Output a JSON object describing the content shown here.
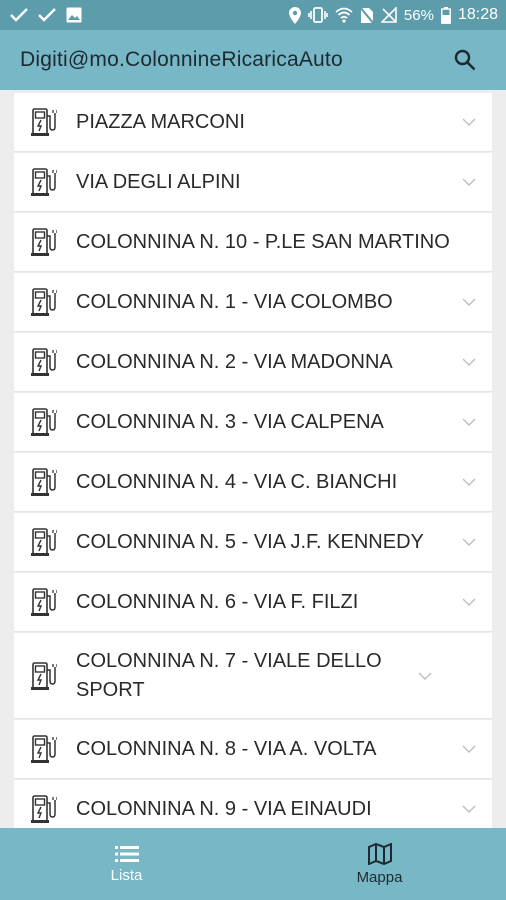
{
  "status_bar": {
    "battery": "56%",
    "time": "18:28",
    "left_icons": [
      "check-icon",
      "check-icon",
      "image-icon"
    ],
    "right_icons": [
      "location-icon",
      "vibrate-icon",
      "wifi-icon",
      "no-sim-icon",
      "no-signal-icon",
      "battery-icon"
    ]
  },
  "app_bar": {
    "title": "Digiti@mo.ColonnineRicaricaAuto",
    "search_icon": "search-icon"
  },
  "list": {
    "items": [
      {
        "label": "PIAZZA MARCONI"
      },
      {
        "label": "VIA DEGLI ALPINI"
      },
      {
        "label": "COLONNINA N. 10 - P.LE SAN MARTINO"
      },
      {
        "label": "COLONNINA N. 1 - VIA COLOMBO"
      },
      {
        "label": "COLONNINA N. 2 - VIA MADONNA"
      },
      {
        "label": "COLONNINA N. 3 - VIA CALPENA"
      },
      {
        "label": "COLONNINA N. 4 - VIA C. BIANCHI"
      },
      {
        "label": "COLONNINA N. 5 - VIA J.F. KENNEDY"
      },
      {
        "label": "COLONNINA N. 6 - VIA F. FILZI"
      },
      {
        "label": "COLONNINA N. 7 - VIALE DELLO SPORT"
      },
      {
        "label": "COLONNINA N. 8 - VIA A. VOLTA"
      },
      {
        "label": "COLONNINA N. 9 - VIA EINAUDI"
      }
    ]
  },
  "bottom_nav": {
    "tabs": [
      {
        "label": "Lista",
        "icon": "list-icon",
        "active": true
      },
      {
        "label": "Mappa",
        "icon": "map-icon",
        "active": false
      }
    ]
  },
  "colors": {
    "status_bar": "#5c9cab",
    "app_bar": "#78b7c6",
    "background": "#ededed"
  }
}
